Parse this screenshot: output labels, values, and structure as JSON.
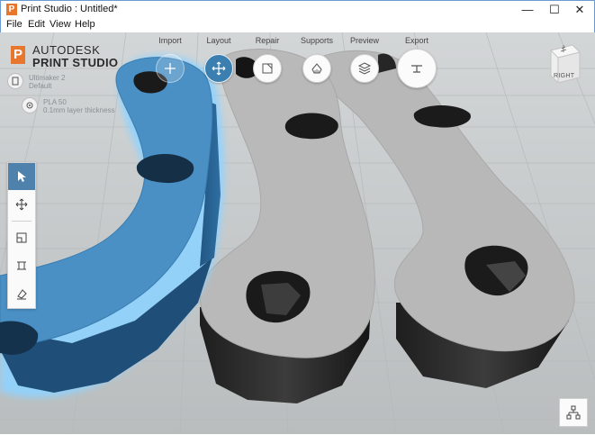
{
  "window": {
    "title": "Print Studio : Untitled*",
    "app_icon_letter": "P",
    "minimize": "—",
    "maximize": "☐",
    "close": "✕"
  },
  "menu": [
    "File",
    "Edit",
    "View",
    "Help"
  ],
  "brand": {
    "line1": "AUTODESK",
    "line2": "PRINT STUDIO",
    "logo_letter": "P",
    "accent": "#e8772e"
  },
  "workflow": {
    "steps": [
      {
        "label": "Import",
        "icon": "plus-icon"
      },
      {
        "label": "Layout",
        "icon": "move-icon"
      },
      {
        "label": "Repair",
        "icon": "repair-icon"
      },
      {
        "label": "Supports",
        "icon": "supports-icon"
      },
      {
        "label": "Preview",
        "icon": "layers-icon"
      },
      {
        "label": "Export",
        "icon": "export-icon"
      }
    ],
    "active_step": "Layout",
    "active_color": "#3b7fb1"
  },
  "printer_info": {
    "printer_name": "Ultimaker 2",
    "printer_sub": "Default",
    "settings_line1": "PLA 50",
    "settings_line2": "0.1mm layer thickness"
  },
  "tools": [
    {
      "name": "select",
      "icon": "cursor-icon",
      "active": true
    },
    {
      "name": "move",
      "icon": "move-arrows-icon",
      "active": false
    },
    {
      "name": "scale",
      "icon": "scale-icon",
      "active": false
    },
    {
      "name": "align",
      "icon": "align-icon",
      "active": false
    },
    {
      "name": "place-on-face",
      "icon": "place-on-face-icon",
      "active": false
    }
  ],
  "viewcube": {
    "face_label": "RIGHT"
  },
  "colors": {
    "selection": "#4a90c5",
    "selection_glow": "#8fd3ff",
    "part_light": "#b9b9b9",
    "part_dark": "#2d2d2d",
    "floor": "#c6cacb"
  }
}
